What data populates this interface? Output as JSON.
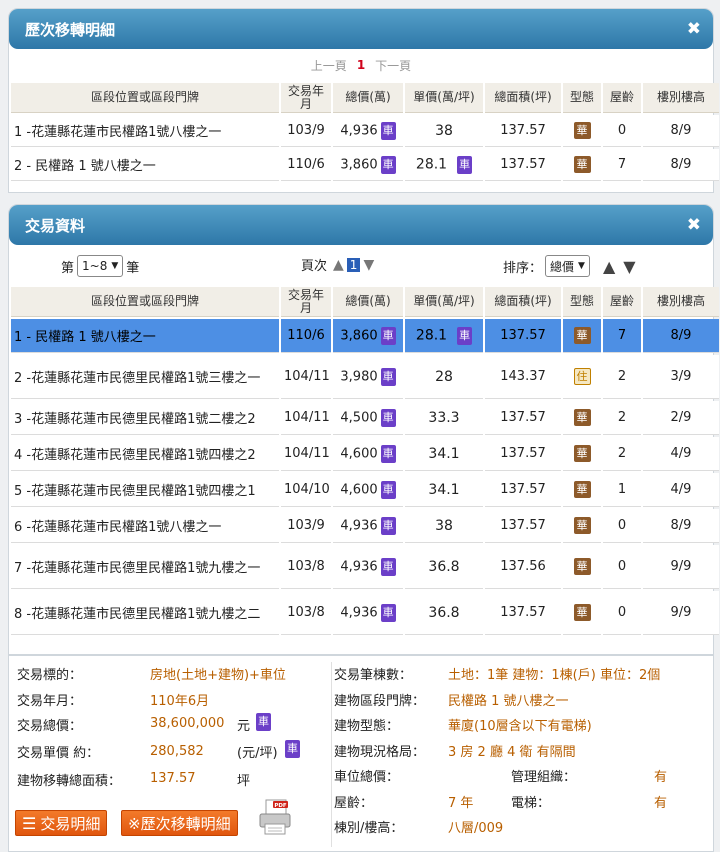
{
  "history": {
    "title": "歷次移轉明細",
    "pager": {
      "prev": "上一頁",
      "current": "1",
      "next": "下一頁"
    },
    "columns": [
      "區段位置或區段門牌",
      "交易年月",
      "總價(萬)",
      "單價(萬/坪)",
      "總面積(坪)",
      "型態",
      "屋齡",
      "樓別樓高"
    ],
    "rows": [
      {
        "no": "1",
        "addr": "-花蓮縣花蓮市民權路1號八樓之一",
        "date": "103/9",
        "total": "4,936",
        "unit": "38",
        "unit_badge": "",
        "area": "137.57",
        "type": "華",
        "age": "0",
        "floor": "8/9"
      },
      {
        "no": "2",
        "addr": "- 民權路 1 號八樓之一",
        "date": "110/6",
        "total": "3,860",
        "unit": "28.1",
        "unit_badge": "車",
        "area": "137.57",
        "type": "華",
        "age": "7",
        "floor": "8/9"
      }
    ]
  },
  "transactions": {
    "title": "交易資料",
    "count_prefix": "第",
    "count_select": "1~8",
    "count_suffix": "筆",
    "page_label": "頁次",
    "page_current": "1",
    "sort_label": "排序：",
    "sort_select": "總價",
    "columns": [
      "區段位置或區段門牌",
      "交易年月",
      "總價(萬)",
      "單價(萬/坪)",
      "總面積(坪)",
      "型態",
      "屋齡",
      "樓別樓高"
    ],
    "rows": [
      {
        "no": "1",
        "addr": "- 民權路 1 號八樓之一",
        "date": "110/6",
        "total": "3,860",
        "unit": "28.1",
        "unit_badge": "車",
        "area": "137.57",
        "type": "華",
        "age": "7",
        "floor": "8/9"
      },
      {
        "no": "2",
        "addr": "-花蓮縣花蓮市民德里民權路1號三樓之一",
        "date": "104/11",
        "total": "3,980",
        "unit": "28",
        "unit_badge": "",
        "area": "143.37",
        "type": "住",
        "age": "2",
        "floor": "3/9"
      },
      {
        "no": "3",
        "addr": "-花蓮縣花蓮市民德里民權路1號二樓之2",
        "date": "104/11",
        "total": "4,500",
        "unit": "33.3",
        "unit_badge": "",
        "area": "137.57",
        "type": "華",
        "age": "2",
        "floor": "2/9"
      },
      {
        "no": "4",
        "addr": "-花蓮縣花蓮市民德里民權路1號四樓之2",
        "date": "104/11",
        "total": "4,600",
        "unit": "34.1",
        "unit_badge": "",
        "area": "137.57",
        "type": "華",
        "age": "2",
        "floor": "4/9"
      },
      {
        "no": "5",
        "addr": "-花蓮縣花蓮市民德里民權路1號四樓之1",
        "date": "104/10",
        "total": "4,600",
        "unit": "34.1",
        "unit_badge": "",
        "area": "137.57",
        "type": "華",
        "age": "1",
        "floor": "4/9"
      },
      {
        "no": "6",
        "addr": "-花蓮縣花蓮市民權路1號八樓之一",
        "date": "103/9",
        "total": "4,936",
        "unit": "38",
        "unit_badge": "",
        "area": "137.57",
        "type": "華",
        "age": "0",
        "floor": "8/9"
      },
      {
        "no": "7",
        "addr": "-花蓮縣花蓮市民德里民權路1號九樓之一",
        "date": "103/8",
        "total": "4,936",
        "unit": "36.8",
        "unit_badge": "",
        "area": "137.56",
        "type": "華",
        "age": "0",
        "floor": "9/9"
      },
      {
        "no": "8",
        "addr": "-花蓮縣花蓮市民德里民權路1號九樓之二",
        "date": "103/8",
        "total": "4,936",
        "unit": "36.8",
        "unit_badge": "",
        "area": "137.57",
        "type": "華",
        "age": "0",
        "floor": "9/9"
      }
    ]
  },
  "total_badge": "車",
  "summary": {
    "left": {
      "target_label": "交易標的：",
      "target_value": "房地(土地+建物)+車位",
      "date_label": "交易年月：",
      "date_value": "110年6月",
      "total_label": "交易總價：",
      "total_value": "38,600,000",
      "total_unit": "元",
      "unit_label": "交易單價 約：",
      "unit_value": "280,582",
      "unit_unit": "(元/坪)",
      "area_label": "建物移轉總面積：",
      "area_value": "137.57",
      "area_unit": "坪"
    },
    "right": {
      "count_label": "交易筆棟數：",
      "count_value": "土地：1筆 建物：1棟(戶) 車位：2個",
      "addr_label": "建物區段門牌：",
      "addr_value": "民權路 1 號八樓之一",
      "type_label": "建物型態：",
      "type_value": "華廈(10層含以下有電梯)",
      "layout_label": "建物現況格局：",
      "layout_value": "3 房 2 廳 4 衛 有隔間",
      "parking_label": "車位總價：",
      "mgmt_label": "管理組織：",
      "mgmt_value": "有",
      "age_label": "屋齡：",
      "age_value": "7 年",
      "elevator_label": "電梯：",
      "elevator_value": "有",
      "floor_label": "棟別/樓高：",
      "floor_value": "八層/009"
    },
    "buttons": {
      "detail": "交易明細",
      "history": "※歷次移轉明細"
    },
    "pdf_label": "PDF"
  }
}
